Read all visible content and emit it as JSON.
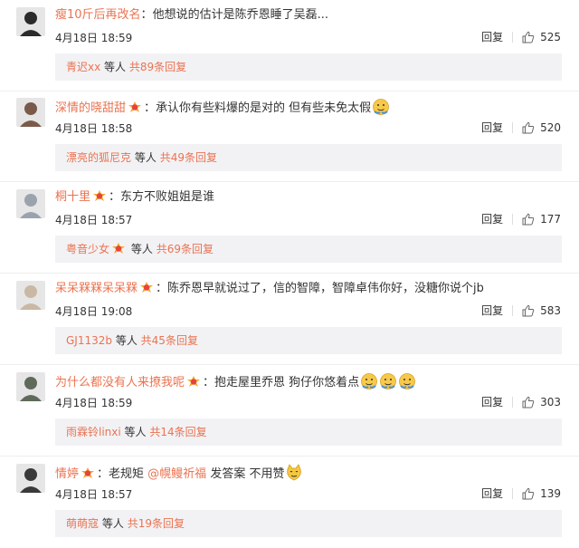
{
  "comments": [
    {
      "user": "瘦10斤后再改名",
      "badge": false,
      "text": "他想说的估计是陈乔恩睡了吴磊...",
      "emojis": 0,
      "time": "4月18日 18:59",
      "reply": "回复",
      "likes": "525",
      "sub_user": "青迟xx",
      "sub_badge": false,
      "sub_mid": "等人",
      "sub_more": "共89条回复",
      "avatar_color": "#2b2b2b"
    },
    {
      "user": "深情的晓甜甜",
      "badge": true,
      "text": "承认你有些料爆的是对的 但有些未免太假",
      "emojis": 1,
      "time": "4月18日 18:58",
      "reply": "回复",
      "likes": "520",
      "sub_user": "漂亮的狐尼克",
      "sub_badge": false,
      "sub_mid": "等人",
      "sub_more": "共49条回复",
      "avatar_color": "#7a5a4a"
    },
    {
      "user": "桐十里",
      "badge": true,
      "text": "东方不败姐姐是谁",
      "emojis": 0,
      "time": "4月18日 18:57",
      "reply": "回复",
      "likes": "177",
      "sub_user": "粤音少女",
      "sub_badge": true,
      "sub_mid": "等人",
      "sub_more": "共69条回复",
      "avatar_color": "#9aa3ad"
    },
    {
      "user": "呆呆槑槑呆呆槑",
      "badge": true,
      "text": "陈乔恩早就说过了，信的智障，智障卓伟你好，没糖你说个jb",
      "emojis": 0,
      "time": "4月18日 19:08",
      "reply": "回复",
      "likes": "583",
      "sub_user": "GJ1132b",
      "sub_badge": false,
      "sub_mid": "等人",
      "sub_more": "共45条回复",
      "avatar_color": "#c9b8a3"
    },
    {
      "user": "为什么都没有人来撩我呢",
      "badge": true,
      "text": "抱走屋里乔恩 狗仔你悠着点",
      "emojis": 3,
      "time": "4月18日 18:59",
      "reply": "回复",
      "likes": "303",
      "sub_user": "雨霖铃linxi",
      "sub_badge": false,
      "sub_mid": "等人",
      "sub_more": "共14条回复",
      "avatar_color": "#5f6b5a"
    },
    {
      "user": "情婷",
      "badge": true,
      "text": "老规矩 ",
      "mention": "@幌鳗祈福",
      "text2": " 发答案 不用赞",
      "emojis": 1,
      "emoji_type": "cat",
      "time": "4月18日 18:57",
      "reply": "回复",
      "likes": "139",
      "sub_user": "萌萌寇",
      "sub_badge": false,
      "sub_mid": "等人",
      "sub_more": "共19条回复",
      "avatar_color": "#3a3a3a"
    }
  ],
  "colors": {
    "accent": "#eb7350",
    "sub_bg": "#f2f2f5",
    "divider": "#eeeeee"
  },
  "icons": {
    "like": "thumbs-up-icon",
    "badge": "vip-badge-icon",
    "emoji": "smiley-emoji-icon"
  }
}
